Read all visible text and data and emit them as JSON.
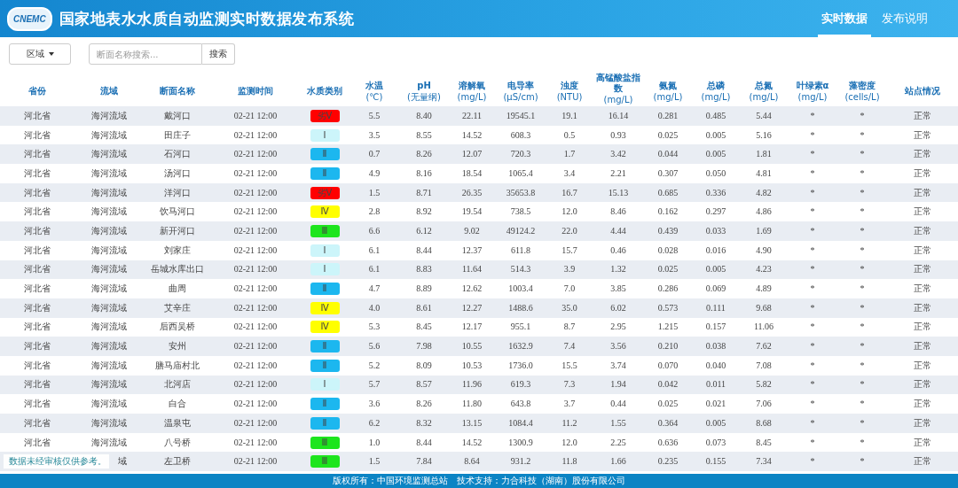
{
  "header": {
    "logo_text": "CNEMC",
    "title": "国家地表水水质自动监测实时数据发布系统",
    "tabs": [
      {
        "label": "实时数据",
        "selected": true
      },
      {
        "label": "发布说明",
        "selected": false
      }
    ]
  },
  "toolbar": {
    "region_dropdown": "区域",
    "search": {
      "placeholder": "断面名称搜索..."
    },
    "search_button": "搜索"
  },
  "table": {
    "columns": [
      {
        "name": "省份"
      },
      {
        "name": "流域"
      },
      {
        "name": "断面名称"
      },
      {
        "name": "监测时间"
      },
      {
        "name": "水质类别"
      },
      {
        "name": "水温",
        "unit": "(℃)"
      },
      {
        "name": "pH",
        "unit": "(无量纲)"
      },
      {
        "name": "溶解氧",
        "unit": "(mg/L)"
      },
      {
        "name": "电导率",
        "unit": "(μS/cm)"
      },
      {
        "name": "浊度",
        "unit": "(NTU)"
      },
      {
        "name": "高锰酸盐指数",
        "unit": "(mg/L)"
      },
      {
        "name": "氨氮",
        "unit": "(mg/L)"
      },
      {
        "name": "总磷",
        "unit": "(mg/L)"
      },
      {
        "name": "总氮",
        "unit": "(mg/L)"
      },
      {
        "name": "叶绿素α",
        "unit": "(mg/L)"
      },
      {
        "name": "藻密度",
        "unit": "(cells/L)"
      },
      {
        "name": "站点情况"
      }
    ],
    "rows": [
      {
        "province": "河北省",
        "basin": "海河流域",
        "section": "戴河口",
        "time": "02-21 12:00",
        "quality": {
          "label": "劣Ⅴ",
          "color": "#ff0000"
        },
        "values": [
          "5.5",
          "8.40",
          "22.11",
          "19545.1",
          "19.1",
          "16.14",
          "0.281",
          "0.485",
          "5.44",
          "*",
          "*",
          "正常"
        ]
      },
      {
        "province": "河北省",
        "basin": "海河流域",
        "section": "田庄子",
        "time": "02-21 12:00",
        "quality": {
          "label": "Ⅰ",
          "color": "#ccf5fa"
        },
        "values": [
          "3.5",
          "8.55",
          "14.52",
          "608.3",
          "0.5",
          "0.93",
          "0.025",
          "0.005",
          "5.16",
          "*",
          "*",
          "正常"
        ]
      },
      {
        "province": "河北省",
        "basin": "海河流域",
        "section": "石河口",
        "time": "02-21 12:00",
        "quality": {
          "label": "Ⅱ",
          "color": "#1cb7ef"
        },
        "values": [
          "0.7",
          "8.26",
          "12.07",
          "720.3",
          "1.7",
          "3.42",
          "0.044",
          "0.005",
          "1.81",
          "*",
          "*",
          "正常"
        ]
      },
      {
        "province": "河北省",
        "basin": "海河流域",
        "section": "汤河口",
        "time": "02-21 12:00",
        "quality": {
          "label": "Ⅱ",
          "color": "#1cb7ef"
        },
        "values": [
          "4.9",
          "8.16",
          "18.54",
          "1065.4",
          "3.4",
          "2.21",
          "0.307",
          "0.050",
          "4.81",
          "*",
          "*",
          "正常"
        ]
      },
      {
        "province": "河北省",
        "basin": "海河流域",
        "section": "洋河口",
        "time": "02-21 12:00",
        "quality": {
          "label": "劣Ⅴ",
          "color": "#ff0000"
        },
        "values": [
          "1.5",
          "8.71",
          "26.35",
          "35653.8",
          "16.7",
          "15.13",
          "0.685",
          "0.336",
          "4.82",
          "*",
          "*",
          "正常"
        ]
      },
      {
        "province": "河北省",
        "basin": "海河流域",
        "section": "饮马河口",
        "time": "02-21 12:00",
        "quality": {
          "label": "Ⅳ",
          "color": "#ffff00"
        },
        "values": [
          "2.8",
          "8.92",
          "19.54",
          "738.5",
          "12.0",
          "8.46",
          "0.162",
          "0.297",
          "4.86",
          "*",
          "*",
          "正常"
        ]
      },
      {
        "province": "河北省",
        "basin": "海河流域",
        "section": "新开河口",
        "time": "02-21 12:00",
        "quality": {
          "label": "Ⅲ",
          "color": "#1de51d"
        },
        "values": [
          "6.6",
          "6.12",
          "9.02",
          "49124.2",
          "22.0",
          "4.44",
          "0.439",
          "0.033",
          "1.69",
          "*",
          "*",
          "正常"
        ]
      },
      {
        "province": "河北省",
        "basin": "海河流域",
        "section": "刘家庄",
        "time": "02-21 12:00",
        "quality": {
          "label": "Ⅰ",
          "color": "#ccf5fa"
        },
        "values": [
          "6.1",
          "8.44",
          "12.37",
          "611.8",
          "15.7",
          "0.46",
          "0.028",
          "0.016",
          "4.90",
          "*",
          "*",
          "正常"
        ]
      },
      {
        "province": "河北省",
        "basin": "海河流域",
        "section": "岳城水库出口",
        "time": "02-21 12:00",
        "quality": {
          "label": "Ⅰ",
          "color": "#ccf5fa"
        },
        "values": [
          "6.1",
          "8.83",
          "11.64",
          "514.3",
          "3.9",
          "1.32",
          "0.025",
          "0.005",
          "4.23",
          "*",
          "*",
          "正常"
        ]
      },
      {
        "province": "河北省",
        "basin": "海河流域",
        "section": "曲周",
        "time": "02-21 12:00",
        "quality": {
          "label": "Ⅱ",
          "color": "#1cb7ef"
        },
        "values": [
          "4.7",
          "8.89",
          "12.62",
          "1003.4",
          "7.0",
          "3.85",
          "0.286",
          "0.069",
          "4.89",
          "*",
          "*",
          "正常"
        ]
      },
      {
        "province": "河北省",
        "basin": "海河流域",
        "section": "艾辛庄",
        "time": "02-21 12:00",
        "quality": {
          "label": "Ⅳ",
          "color": "#ffff00"
        },
        "values": [
          "4.0",
          "8.61",
          "12.27",
          "1488.6",
          "35.0",
          "6.02",
          "0.573",
          "0.111",
          "9.68",
          "*",
          "*",
          "正常"
        ]
      },
      {
        "province": "河北省",
        "basin": "海河流域",
        "section": "后西吴桥",
        "time": "02-21 12:00",
        "quality": {
          "label": "Ⅳ",
          "color": "#ffff00"
        },
        "values": [
          "5.3",
          "8.45",
          "12.17",
          "955.1",
          "8.7",
          "2.95",
          "1.215",
          "0.157",
          "11.06",
          "*",
          "*",
          "正常"
        ]
      },
      {
        "province": "河北省",
        "basin": "海河流域",
        "section": "安州",
        "time": "02-21 12:00",
        "quality": {
          "label": "Ⅱ",
          "color": "#1cb7ef"
        },
        "values": [
          "5.6",
          "7.98",
          "10.55",
          "1632.9",
          "7.4",
          "3.56",
          "0.210",
          "0.038",
          "7.62",
          "*",
          "*",
          "正常"
        ]
      },
      {
        "province": "河北省",
        "basin": "海河流域",
        "section": "膳马庙村北",
        "time": "02-21 12:00",
        "quality": {
          "label": "Ⅱ",
          "color": "#1cb7ef"
        },
        "values": [
          "5.2",
          "8.09",
          "10.53",
          "1736.0",
          "15.5",
          "3.74",
          "0.070",
          "0.040",
          "7.08",
          "*",
          "*",
          "正常"
        ]
      },
      {
        "province": "河北省",
        "basin": "海河流域",
        "section": "北河店",
        "time": "02-21 12:00",
        "quality": {
          "label": "Ⅰ",
          "color": "#ccf5fa"
        },
        "values": [
          "5.7",
          "8.57",
          "11.96",
          "619.3",
          "7.3",
          "1.94",
          "0.042",
          "0.011",
          "5.82",
          "*",
          "*",
          "正常"
        ]
      },
      {
        "province": "河北省",
        "basin": "海河流域",
        "section": "白合",
        "time": "02-21 12:00",
        "quality": {
          "label": "Ⅱ",
          "color": "#1cb7ef"
        },
        "values": [
          "3.6",
          "8.26",
          "11.80",
          "643.8",
          "3.7",
          "0.44",
          "0.025",
          "0.021",
          "7.06",
          "*",
          "*",
          "正常"
        ]
      },
      {
        "province": "河北省",
        "basin": "海河流域",
        "section": "温泉屯",
        "time": "02-21 12:00",
        "quality": {
          "label": "Ⅱ",
          "color": "#1cb7ef"
        },
        "values": [
          "6.2",
          "8.32",
          "13.15",
          "1084.4",
          "11.2",
          "1.55",
          "0.364",
          "0.005",
          "8.68",
          "*",
          "*",
          "正常"
        ]
      },
      {
        "province": "河北省",
        "basin": "海河流域",
        "section": "八号桥",
        "time": "02-21 12:00",
        "quality": {
          "label": "Ⅲ",
          "color": "#1de51d"
        },
        "values": [
          "1.0",
          "8.44",
          "14.52",
          "1300.9",
          "12.0",
          "2.25",
          "0.636",
          "0.073",
          "8.45",
          "*",
          "*",
          "正常"
        ]
      },
      {
        "basin": "域",
        "section": "左卫桥",
        "time": "02-21 12:00",
        "quality": {
          "label": "Ⅲ",
          "color": "#1de51d"
        },
        "values": [
          "1.5",
          "7.84",
          "8.64",
          "931.2",
          "11.8",
          "1.66",
          "0.235",
          "0.155",
          "7.34",
          "*",
          "*",
          "正常"
        ]
      }
    ]
  },
  "notice": "数据未经审核仅供参考。",
  "footer": "版权所有：中国环境监测总站　技术支持：力合科技（湖南）股份有限公司"
}
